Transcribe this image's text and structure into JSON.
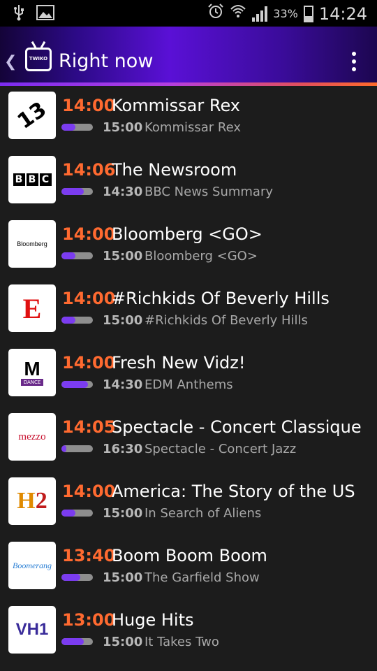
{
  "status_bar": {
    "battery_percent": "33%",
    "time": "14:24",
    "icons": [
      "usb-icon",
      "image-icon",
      "alarm-icon",
      "wifi-icon",
      "signal-icon",
      "battery-icon"
    ]
  },
  "action_bar": {
    "title": "Right now",
    "app_logo_text": "TWIKO",
    "colors": {
      "accent_gradient_start": "#7b2cf0",
      "accent_gradient_end": "#ff6a2a"
    }
  },
  "colors": {
    "now_time": "#ff6a30",
    "progress_fill": "#7b3cf0",
    "progress_track": "#8e8e8e",
    "background": "#1c1c1c"
  },
  "channels": [
    {
      "logo": "13 Street",
      "logo_text": "13",
      "now_time": "14:00",
      "now_title": "Kommissar Rex",
      "progress": 0.45,
      "next_time": "15:00",
      "next_title": "Kommissar Rex"
    },
    {
      "logo": "BBC",
      "logo_text": "BBC",
      "now_time": "14:06",
      "now_title": "The Newsroom",
      "progress": 0.7,
      "next_time": "14:30",
      "next_title": "BBC News Summary"
    },
    {
      "logo": "Bloomberg",
      "logo_text": "Bloomberg",
      "now_time": "14:00",
      "now_title": "Bloomberg <GO>",
      "progress": 0.45,
      "next_time": "15:00",
      "next_title": "Bloomberg <GO>"
    },
    {
      "logo": "E!",
      "logo_text": "E",
      "now_time": "14:00",
      "now_title": "#Richkids Of Beverly Hills",
      "progress": 0.45,
      "next_time": "15:00",
      "next_title": "#Richkids Of Beverly Hills"
    },
    {
      "logo": "MTV Dance",
      "logo_text": "M",
      "logo_subtext": "DANCE",
      "now_time": "14:00",
      "now_title": "Fresh New Vidz!",
      "progress": 0.85,
      "next_time": "14:30",
      "next_title": "EDM Anthems"
    },
    {
      "logo": "mezzo",
      "logo_text": "mezzo",
      "now_time": "14:05",
      "now_title": "Spectacle - Concert Classique",
      "progress": 0.15,
      "next_time": "16:30",
      "next_title": "Spectacle - Concert Jazz"
    },
    {
      "logo": "H2",
      "logo_text": "H2",
      "now_time": "14:00",
      "now_title": "America: The Story of the US",
      "progress": 0.45,
      "next_time": "15:00",
      "next_title": "In Search of Aliens"
    },
    {
      "logo": "Boomerang",
      "logo_text": "Boomerang",
      "now_time": "13:40",
      "now_title": "Boom Boom Boom",
      "progress": 0.6,
      "next_time": "15:00",
      "next_title": "The Garfield Show"
    },
    {
      "logo": "VH1",
      "logo_text": "VH1",
      "now_time": "13:00",
      "now_title": "Huge Hits",
      "progress": 0.7,
      "next_time": "15:00",
      "next_title": "It Takes Two"
    }
  ]
}
